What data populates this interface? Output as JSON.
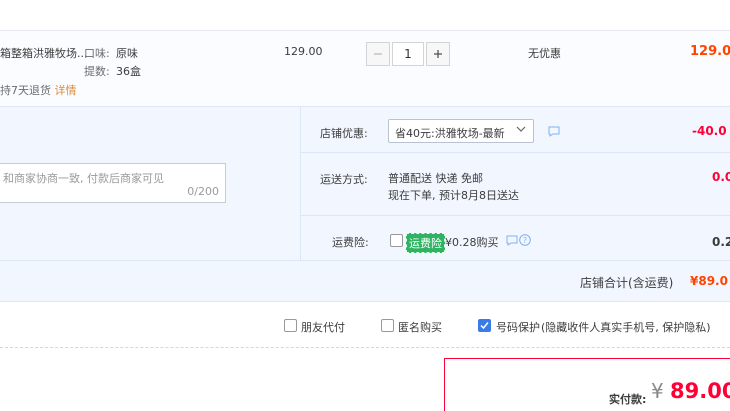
{
  "item": {
    "title": "箱整箱洪雅牧场...",
    "sku_flavor_label": "口味:",
    "sku_flavor_value": "原味",
    "sku_pack_label": "提数:",
    "sku_pack_value": "36盒",
    "refund_text": "持7天退货",
    "refund_link": "详情",
    "unit_price": "129.00",
    "quantity": "1",
    "discount": "无优惠",
    "subtotal": "129.0"
  },
  "message": {
    "placeholder": "和商家协商一致, 付款后商家可见",
    "counter": "0/200"
  },
  "store_discount": {
    "label": "店铺优惠:",
    "selected": "省40元:洪雅牧场-最新",
    "value": "-40.0"
  },
  "shipping": {
    "label": "运送方式:",
    "method": "普通配送 快递 免邮",
    "eta": "现在下单, 预计8月8日送达",
    "value": "0.0"
  },
  "insurance": {
    "label": "运费险:",
    "badge": "运费险",
    "price_text": "¥0.28购买",
    "value": "0.2"
  },
  "store_total": {
    "label": "店铺合计(含运费)",
    "value": "¥89.0"
  },
  "options": {
    "friend_pay": "朋友代付",
    "anonymous": "匿名购买",
    "privacy": "号码保护",
    "privacy_note": "(隐藏收件人真实手机号, 保护隐私)",
    "privacy_checked": true
  },
  "payment": {
    "label": "实付款:",
    "currency": "¥",
    "amount": "89.00"
  },
  "colors": {
    "accent_red": "#ff0036",
    "price_orange": "#ff4400",
    "link_orange": "#e08b3b",
    "checkbox_blue": "#3a7bea",
    "insurance_green": "#2fb362"
  }
}
